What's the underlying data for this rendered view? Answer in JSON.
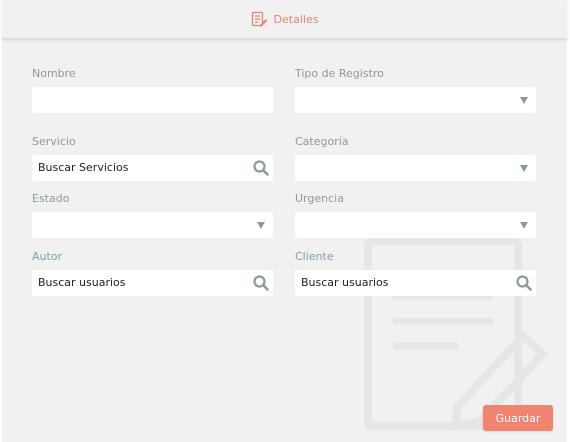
{
  "header": {
    "title": "Detalles",
    "icon": "edit-document-icon"
  },
  "fields": {
    "nombre": {
      "label": "Nombre",
      "value": ""
    },
    "tipo_registro": {
      "label": "Tipo de Registro",
      "value": ""
    },
    "servicio": {
      "label": "Servicio",
      "value": "Buscar Servicios"
    },
    "categoria": {
      "label": "Categoría",
      "value": ""
    },
    "estado": {
      "label": "Estado",
      "value": ""
    },
    "urgencia": {
      "label": "Urgencia",
      "value": ""
    },
    "autor": {
      "label": "Autor",
      "value": "Buscar usuarios"
    },
    "cliente": {
      "label": "Cliente",
      "value": "Buscar usuarios"
    }
  },
  "actions": {
    "save_label": "Guardar"
  },
  "colors": {
    "accent": "#f08470",
    "label": "#8a9aa0",
    "background": "#f1f1f1",
    "icon": "#8c9a9d"
  }
}
